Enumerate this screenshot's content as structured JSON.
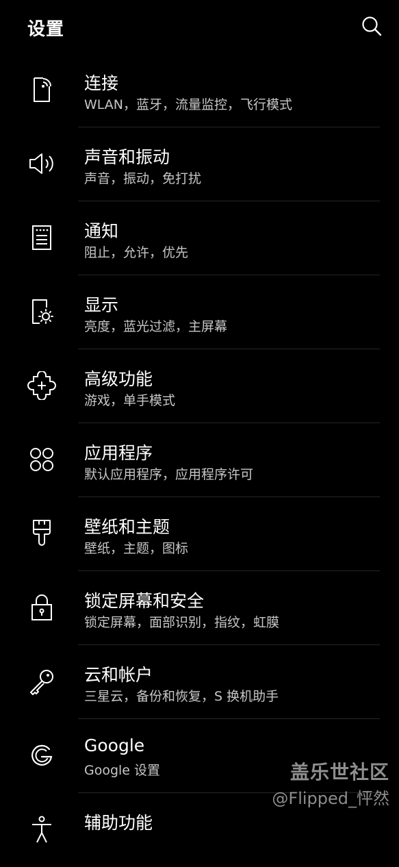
{
  "header": {
    "title": "设置",
    "search_icon": "search-icon"
  },
  "items": [
    {
      "title": "连接",
      "subtitle": "WLAN，蓝牙，流量监控，飞行模式",
      "icon": "connections-icon"
    },
    {
      "title": "声音和振动",
      "subtitle": "声音，振动，免打扰",
      "icon": "speaker-icon"
    },
    {
      "title": "通知",
      "subtitle": "阻止，允许，优先",
      "icon": "notifications-icon"
    },
    {
      "title": "显示",
      "subtitle": "亮度，蓝光过滤，主屏幕",
      "icon": "display-brightness-icon"
    },
    {
      "title": "高级功能",
      "subtitle": "游戏，单手模式",
      "icon": "puzzle-plus-icon"
    },
    {
      "title": "应用程序",
      "subtitle": "默认应用程序，应用程序许可",
      "icon": "apps-grid-icon"
    },
    {
      "title": "壁纸和主题",
      "subtitle": "壁纸，主题，图标",
      "icon": "paint-brush-icon"
    },
    {
      "title": "锁定屏幕和安全",
      "subtitle": "锁定屏幕，面部识别，指纹，虹膜",
      "icon": "lock-icon"
    },
    {
      "title": "云和帐户",
      "subtitle": "三星云，备份和恢复，S 换机助手",
      "icon": "key-icon"
    },
    {
      "title": "Google",
      "subtitle": "Google 设置",
      "icon": "google-icon"
    },
    {
      "title": "辅助功能",
      "subtitle": "",
      "icon": "accessibility-icon"
    }
  ],
  "watermark": {
    "site": "盖乐世社区",
    "user": "@Flipped_怦然"
  }
}
